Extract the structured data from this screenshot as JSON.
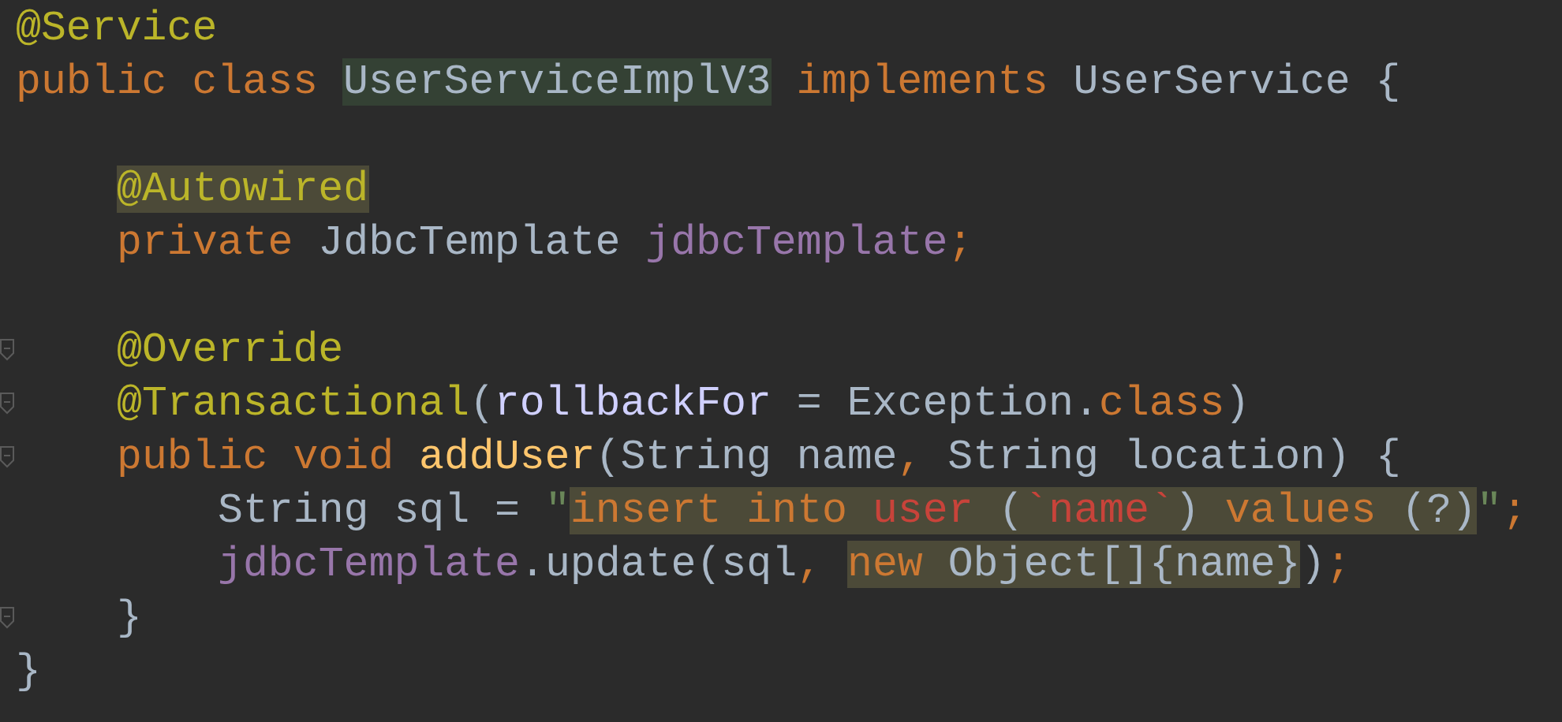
{
  "editor": {
    "lines": [
      {
        "kind": "code",
        "fold_marker": false,
        "tokens": [
          {
            "text": "@Service",
            "kind": "annotation",
            "highlighted": false
          }
        ]
      },
      {
        "kind": "code",
        "fold_marker": false,
        "tokens": [
          {
            "text": "public class ",
            "kind": "keyword",
            "highlighted": false
          },
          {
            "text": "UserServiceImplV3",
            "kind": "declaration",
            "highlighted": true
          },
          {
            "text": " implements ",
            "kind": "keyword",
            "highlighted": false
          },
          {
            "text": "UserService {",
            "kind": "plain",
            "highlighted": false
          }
        ],
        "children": [
          {
            "kind": "blank"
          },
          {
            "kind": "code",
            "fold_marker": false,
            "tokens": [
              {
                "text": "@Autowired",
                "kind": "annotation",
                "highlighted": true
              }
            ]
          },
          {
            "kind": "code",
            "fold_marker": false,
            "tokens": [
              {
                "text": "private ",
                "kind": "keyword",
                "highlighted": false
              },
              {
                "text": "JdbcTemplate ",
                "kind": "plain",
                "highlighted": false
              },
              {
                "text": "jdbcTemplate",
                "kind": "field",
                "highlighted": false
              },
              {
                "text": ";",
                "kind": "keyword",
                "highlighted": false
              }
            ]
          },
          {
            "kind": "blank"
          },
          {
            "kind": "code",
            "fold_marker": true,
            "tokens": [
              {
                "text": "@Override",
                "kind": "annotation",
                "highlighted": false
              }
            ]
          },
          {
            "kind": "code",
            "fold_marker": true,
            "tokens": [
              {
                "text": "@Transactional",
                "kind": "annotation",
                "highlighted": false
              },
              {
                "text": "(",
                "kind": "plain",
                "highlighted": false
              },
              {
                "text": "rollbackFor",
                "kind": "param",
                "highlighted": false
              },
              {
                "text": " = Exception.",
                "kind": "plain",
                "highlighted": false
              },
              {
                "text": "class",
                "kind": "keyword",
                "highlighted": false
              },
              {
                "text": ")",
                "kind": "plain",
                "highlighted": false
              }
            ]
          },
          {
            "kind": "code",
            "fold_marker": true,
            "tokens": [
              {
                "text": "public void ",
                "kind": "keyword",
                "highlighted": false
              },
              {
                "text": "addUser",
                "kind": "method",
                "highlighted": false
              },
              {
                "text": "(String name",
                "kind": "plain",
                "highlighted": false
              },
              {
                "text": ", ",
                "kind": "keyword",
                "highlighted": false
              },
              {
                "text": "String location) {",
                "kind": "plain",
                "highlighted": false
              }
            ],
            "children": [
              {
                "kind": "code",
                "fold_marker": false,
                "tokens": [
                  {
                    "text": "String sql = ",
                    "kind": "plain",
                    "highlighted": false
                  },
                  {
                    "text": "\"",
                    "kind": "string",
                    "highlighted": false
                  },
                  {
                    "text": "insert into ",
                    "kind": "sql_keyword",
                    "highlighted": true
                  },
                  {
                    "text": "user",
                    "kind": "sql_table",
                    "highlighted": true
                  },
                  {
                    "text": " (",
                    "kind": "plain",
                    "highlighted": true
                  },
                  {
                    "text": "`name`",
                    "kind": "sql_table",
                    "highlighted": true
                  },
                  {
                    "text": ") ",
                    "kind": "plain",
                    "highlighted": true
                  },
                  {
                    "text": "values ",
                    "kind": "sql_keyword",
                    "highlighted": true
                  },
                  {
                    "text": "(?)",
                    "kind": "plain",
                    "highlighted": true
                  },
                  {
                    "text": "\"",
                    "kind": "string",
                    "highlighted": false
                  },
                  {
                    "text": ";",
                    "kind": "keyword",
                    "highlighted": false
                  }
                ]
              },
              {
                "kind": "code",
                "fold_marker": false,
                "tokens": [
                  {
                    "text": "jdbcTemplate",
                    "kind": "field",
                    "highlighted": false
                  },
                  {
                    "text": ".update(sql",
                    "kind": "plain",
                    "highlighted": false
                  },
                  {
                    "text": ", ",
                    "kind": "keyword",
                    "highlighted": false
                  },
                  {
                    "text": "new ",
                    "kind": "keyword",
                    "highlighted": true
                  },
                  {
                    "text": "Object[]{name}",
                    "kind": "plain",
                    "highlighted": true
                  },
                  {
                    "text": ")",
                    "kind": "plain",
                    "highlighted": false
                  },
                  {
                    "text": ";",
                    "kind": "keyword",
                    "highlighted": false
                  }
                ]
              }
            ]
          },
          {
            "kind": "code",
            "fold_marker": true,
            "tokens": [
              {
                "text": "}",
                "kind": "plain",
                "highlighted": false
              }
            ]
          }
        ]
      },
      {
        "kind": "code",
        "fold_marker": false,
        "tokens": [
          {
            "text": "}",
            "kind": "plain",
            "highlighted": false
          }
        ]
      }
    ]
  }
}
